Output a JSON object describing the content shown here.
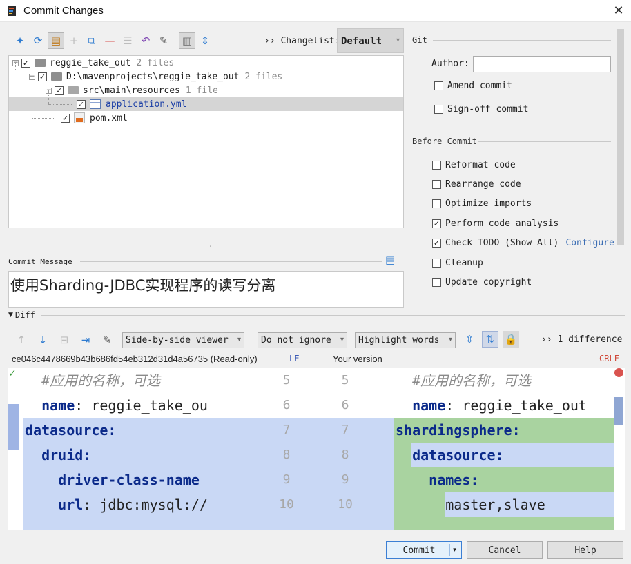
{
  "window": {
    "title": "Commit Changes",
    "close_glyph": "✕"
  },
  "toolbar": {
    "icons": [
      "pin-icon",
      "refresh-icon",
      "edit-source-icon",
      "add-icon",
      "move-icon",
      "remove-icon",
      "show-diff-icon",
      "rollback-icon",
      "edit-icon",
      "group-icon",
      "expand-all-icon"
    ],
    "changelist_label": "›› Changelist:",
    "changelist_value": "Default"
  },
  "tree": {
    "rows": [
      {
        "name": "reggie_take_out",
        "meta": "2 files"
      },
      {
        "name": "D:\\mavenprojects\\reggie_take_out",
        "meta": "2 files"
      },
      {
        "name": "src\\main\\resources",
        "meta": "1 file"
      },
      {
        "name": "application.yml",
        "meta": ""
      },
      {
        "name": "pom.xml",
        "meta": ""
      }
    ]
  },
  "git": {
    "section_label": "Git",
    "author_label": "Author:",
    "author_value": "",
    "amend_label": "Amend commit",
    "signoff_label": "Sign-off commit"
  },
  "before_commit": {
    "section_label": "Before Commit",
    "options": [
      {
        "label": "Reformat code",
        "checked": false
      },
      {
        "label": "Rearrange code",
        "checked": false
      },
      {
        "label": "Optimize imports",
        "checked": false
      },
      {
        "label": "Perform code analysis",
        "checked": true
      },
      {
        "label": "Check TODO (Show All)",
        "checked": true
      },
      {
        "label": "Cleanup",
        "checked": false
      },
      {
        "label": "Update copyright",
        "checked": false
      }
    ],
    "configure_link": "Configure"
  },
  "commit_message": {
    "label": "Commit Message",
    "value": "使用Sharding-JDBC实现程序的读写分离"
  },
  "diff": {
    "label": "Diff",
    "viewer": "Side-by-side viewer",
    "ignore": "Do not ignore",
    "highlight": "Highlight words",
    "difference_count": "›› 1 difference",
    "left_title": "ce046c4478669b43b686fd54eb312d31d4a56735 (Read-only)",
    "left_eol": "LF",
    "right_title": "Your version",
    "right_eol": "CRLF",
    "left_lines": [
      {
        "num": "5",
        "text": "  #应用的名称，可选"
      },
      {
        "num": "6",
        "text": "  name: reggie_take_ou"
      },
      {
        "num": "7",
        "text": "datasource:"
      },
      {
        "num": "8",
        "text": "  druid:"
      },
      {
        "num": "9",
        "text": "    driver-class-name"
      },
      {
        "num": "10",
        "text": "    url: jdbc:mysql://"
      }
    ],
    "right_lines": [
      {
        "num": "5",
        "text": "  #应用的名称，可选"
      },
      {
        "num": "6",
        "text": "  name: reggie_take_out"
      },
      {
        "num": "7",
        "text": "shardingsphere:"
      },
      {
        "num": "8",
        "text": "  datasource:"
      },
      {
        "num": "9",
        "text": "    names:"
      },
      {
        "num": "10",
        "text": "      master,slave"
      }
    ]
  },
  "buttons": {
    "commit": "Commit",
    "cancel": "Cancel",
    "help": "Help"
  },
  "colors": {
    "blue_highlight": "#c9d8f5",
    "green_highlight": "#a9d3a0",
    "link": "#3c6eb4"
  }
}
